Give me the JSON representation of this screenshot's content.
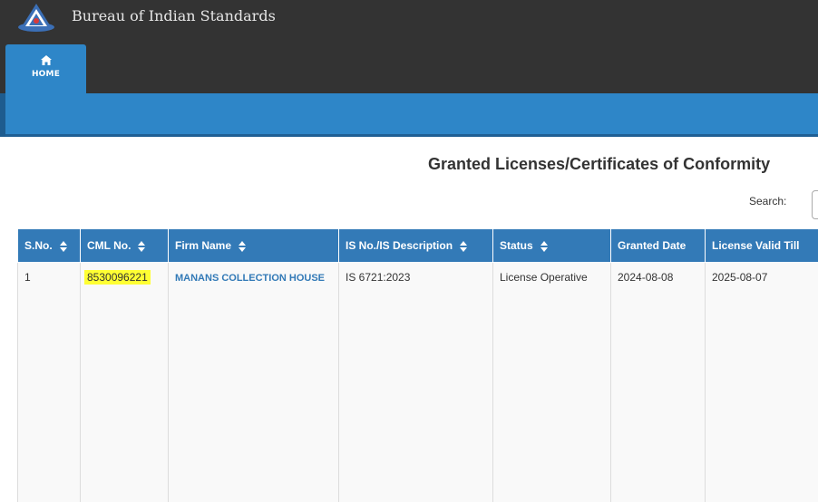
{
  "header": {
    "org_name": "Bureau of Indian Standards",
    "home_label": "HOME"
  },
  "page": {
    "title": "Granted Licenses/Certificates of Conformity",
    "search_label": "Search:",
    "search_value": ""
  },
  "table": {
    "columns": [
      {
        "label": "S.No.",
        "sortable": true
      },
      {
        "label": "CML No.",
        "sortable": true
      },
      {
        "label": "Firm Name",
        "sortable": true
      },
      {
        "label": "IS No./IS Description",
        "sortable": true
      },
      {
        "label": "Status",
        "sortable": true
      },
      {
        "label": "Granted Date",
        "sortable": false
      },
      {
        "label": "License Valid Till",
        "sortable": false
      }
    ],
    "rows": [
      {
        "sno": "1",
        "cml_no": "8530096221",
        "firm_name": "MANANS COLLECTION HOUSE",
        "is_no": "IS 6721:2023",
        "status": "License Operative",
        "granted_date": "2024-08-08",
        "valid_till": "2025-08-07"
      }
    ]
  },
  "colors": {
    "topbar": "#333333",
    "accent": "#2e86c8",
    "table_header": "#337ab7",
    "highlight": "#ffff33"
  }
}
